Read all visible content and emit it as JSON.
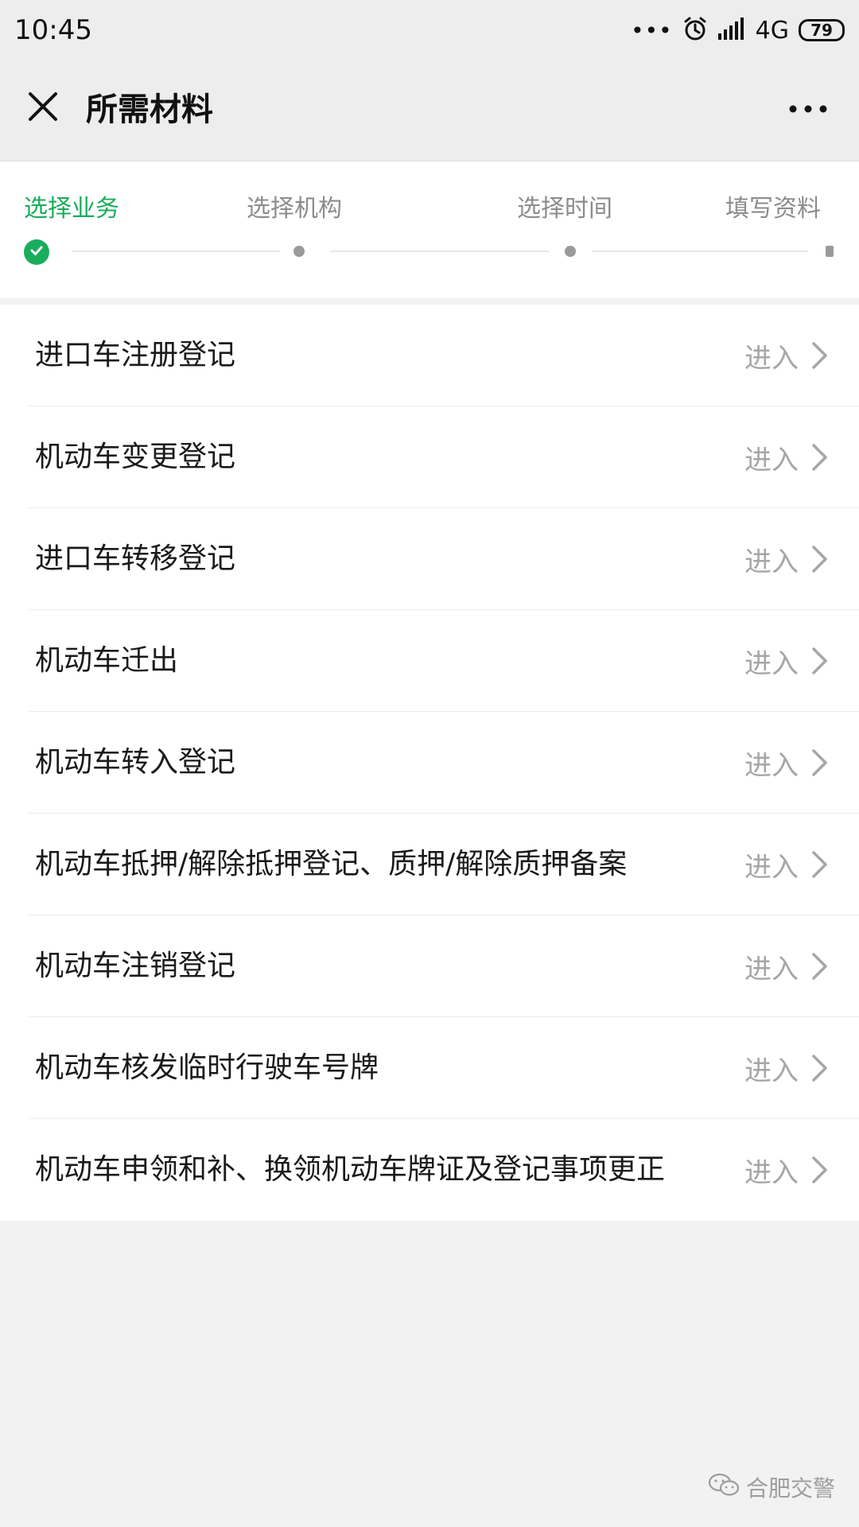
{
  "status_bar": {
    "time": "10:45",
    "dots": "•••",
    "network": "4G",
    "battery": "79"
  },
  "header": {
    "title": "所需材料"
  },
  "stepper": {
    "steps": [
      {
        "label": "选择业务",
        "state": "done"
      },
      {
        "label": "选择机构",
        "state": "pending"
      },
      {
        "label": "选择时间",
        "state": "pending"
      },
      {
        "label": "填写资料",
        "state": "pending"
      }
    ],
    "active_color": "#1aad5c"
  },
  "list": {
    "enter_label": "进入",
    "items": [
      {
        "label": "进口车注册登记"
      },
      {
        "label": "机动车变更登记"
      },
      {
        "label": "进口车转移登记"
      },
      {
        "label": "机动车迁出"
      },
      {
        "label": "机动车转入登记"
      },
      {
        "label": "机动车抵押/解除抵押登记、质押/解除质押备案"
      },
      {
        "label": "机动车注销登记"
      },
      {
        "label": "机动车核发临时行驶车号牌"
      },
      {
        "label": "机动车申领和补、换领机动车牌证及登记事项更正"
      }
    ]
  },
  "watermark": {
    "text": "合肥交警"
  },
  "icons": {
    "close": "close-icon",
    "more": "more-icon",
    "check": "check-icon",
    "chevron": "chevron-right-icon",
    "alarm": "alarm-icon",
    "signal": "signal-icon",
    "wechat": "wechat-icon"
  }
}
